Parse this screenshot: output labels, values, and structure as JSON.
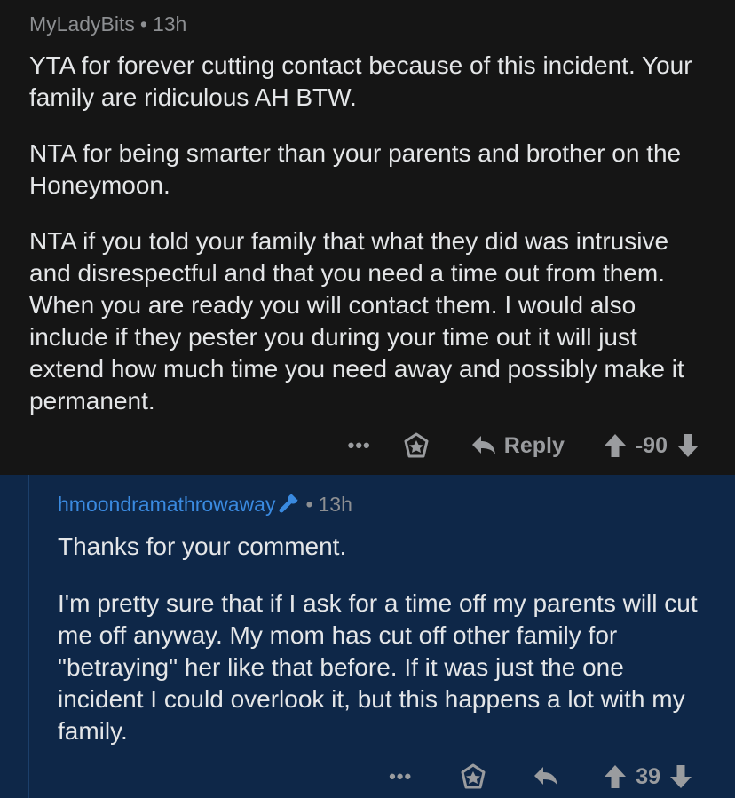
{
  "comments": [
    {
      "username": "MyLadyBits",
      "time": "13h",
      "paragraphs": [
        "YTA for forever cutting contact because of this incident. Your family are ridiculous AH BTW.",
        "NTA for being smarter than your parents and brother on the Honeymoon.",
        "NTA if you told your family that what they did was intrusive and disrespectful and that you need a time out from them. When you are ready you will contact them. I would also include if they pester you during your time out it will just extend how much time you need away and possibly make it permanent."
      ],
      "more_label": "•••",
      "reply_label": "Reply",
      "score": "-90"
    },
    {
      "username": "hmoondramathrowaway",
      "time": "13h",
      "paragraphs": [
        "Thanks for your comment.",
        "I'm pretty sure that if I ask for a time off my parents will cut me off anyway. My mom has cut off other family for \"betraying\" her like that before.  If it was just the one incident I could overlook it, but this happens a lot with my family."
      ],
      "more_label": "•••",
      "score": "39"
    }
  ],
  "separator": "•",
  "colors": {
    "background_top": "#151515",
    "background_reply": "#0e2748",
    "op_username": "#3a8ae0",
    "action_gray": "#9a9c9f"
  },
  "icons": [
    "award-icon",
    "reply-arrow-icon",
    "upvote-icon",
    "downvote-icon",
    "wrench-icon"
  ]
}
